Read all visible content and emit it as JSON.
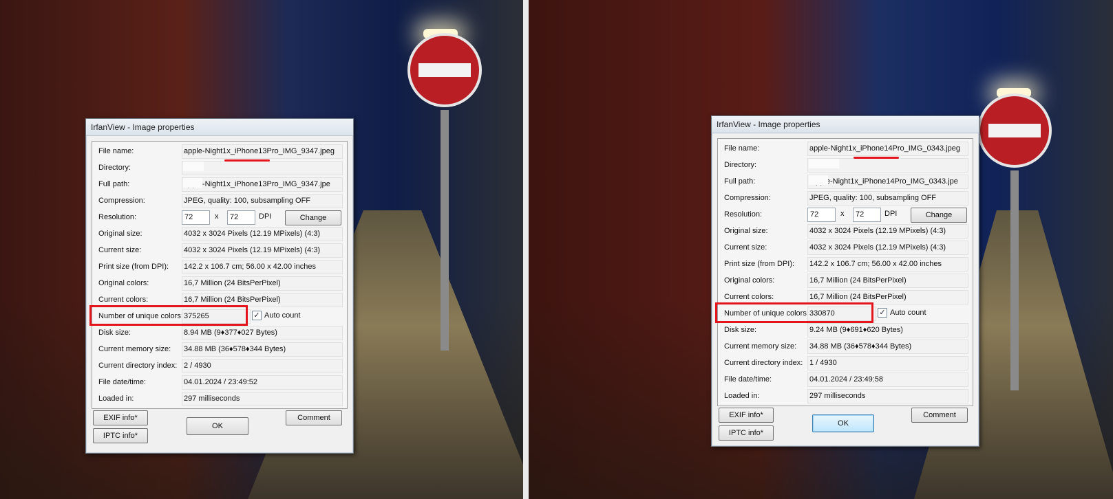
{
  "left": {
    "title": "IrfanView - Image properties",
    "rows": [
      {
        "label": "File name:",
        "value": "apple-Night1x_iPhone13Pro_IMG_9347.jpeg"
      },
      {
        "label": "Directory:",
        "value": ""
      },
      {
        "label": "Full path:",
        "value": "apple-Night1x_iPhone13Pro_IMG_9347.jpe"
      },
      {
        "label": "Compression:",
        "value": "JPEG, quality: 100, subsampling OFF"
      },
      {
        "label": "Resolution:",
        "value": ""
      },
      {
        "label": "Original size:",
        "value": "4032 x 3024  Pixels (12.19 MPixels) (4:3)"
      },
      {
        "label": "Current size:",
        "value": "4032 x 3024  Pixels (12.19 MPixels) (4:3)"
      },
      {
        "label": "Print size (from DPI):",
        "value": "142.2 x 106.7 cm; 56.00 x 42.00 inches"
      },
      {
        "label": "Original colors:",
        "value": "16,7 Million   (24 BitsPerPixel)"
      },
      {
        "label": "Current colors:",
        "value": "16,7 Million   (24 BitsPerPixel)"
      },
      {
        "label": "Number of unique colors:",
        "value": "375265"
      },
      {
        "label": "Disk size:",
        "value": "8.94 MB (9♦377♦027 Bytes)"
      },
      {
        "label": "Current memory size:",
        "value": "34.88  MB (36♦578♦344 Bytes)"
      },
      {
        "label": "Current directory index:",
        "value": "2  /  4930"
      },
      {
        "label": "File date/time:",
        "value": "04.01.2024 / 23:49:52"
      },
      {
        "label": "Loaded in:",
        "value": "297 milliseconds"
      }
    ],
    "dpi_x": "72",
    "dpi_x_sep": "x",
    "dpi_y": "72",
    "dpi_unit": "DPI",
    "auto_count": "Auto count",
    "change": "Change",
    "exif": "EXIF info*",
    "iptc": "IPTC info*",
    "ok": "OK",
    "comment": "Comment"
  },
  "right": {
    "title": "IrfanView - Image properties",
    "rows": [
      {
        "label": "File name:",
        "value": "apple-Night1x_iPhone14Pro_IMG_0343.jpeg"
      },
      {
        "label": "Directory:",
        "value": ""
      },
      {
        "label": "Full path:",
        "value": "\\apple-Night1x_iPhone14Pro_IMG_0343.jpe"
      },
      {
        "label": "Compression:",
        "value": "JPEG, quality: 100, subsampling OFF"
      },
      {
        "label": "Resolution:",
        "value": ""
      },
      {
        "label": "Original size:",
        "value": "4032 x 3024  Pixels (12.19 MPixels) (4:3)"
      },
      {
        "label": "Current size:",
        "value": "4032 x 3024  Pixels (12.19 MPixels) (4:3)"
      },
      {
        "label": "Print size (from DPI):",
        "value": "142.2 x 106.7 cm; 56.00 x 42.00 inches"
      },
      {
        "label": "Original colors:",
        "value": "16,7 Million   (24 BitsPerPixel)"
      },
      {
        "label": "Current colors:",
        "value": "16,7 Million   (24 BitsPerPixel)"
      },
      {
        "label": "Number of unique colors:",
        "value": "330870"
      },
      {
        "label": "Disk size:",
        "value": "9.24 MB (9♦691♦620 Bytes)"
      },
      {
        "label": "Current memory size:",
        "value": "34.88  MB (36♦578♦344 Bytes)"
      },
      {
        "label": "Current directory index:",
        "value": "1  /  4930"
      },
      {
        "label": "File date/time:",
        "value": "04.01.2024 / 23:49:58"
      },
      {
        "label": "Loaded in:",
        "value": "297 milliseconds"
      }
    ],
    "dpi_x": "72",
    "dpi_x_sep": "x",
    "dpi_y": "72",
    "dpi_unit": "DPI",
    "auto_count": "Auto count",
    "change": "Change",
    "exif": "EXIF info*",
    "iptc": "IPTC info*",
    "ok": "OK",
    "comment": "Comment"
  },
  "colors": {
    "highlight": "#e3141c",
    "sign_red": "#b81e23"
  }
}
